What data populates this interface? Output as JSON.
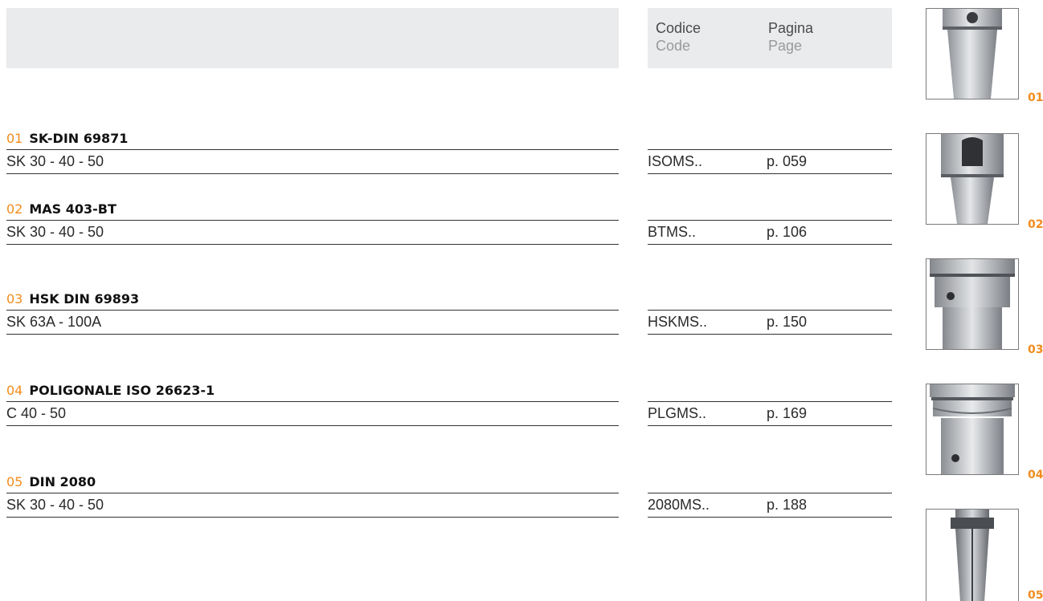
{
  "header": {
    "code_it": "Codice",
    "code_en": "Code",
    "page_it": "Pagina",
    "page_en": "Page"
  },
  "sections": [
    {
      "num": "01",
      "title": "SK-DIN 69871",
      "spec": "SK 30 - 40 - 50",
      "code": "ISOMS..",
      "page": "p. 059"
    },
    {
      "num": "02",
      "title": "MAS 403-BT",
      "spec": "SK 30 - 40 - 50",
      "code": "BTMS..",
      "page": "p. 106"
    },
    {
      "num": "03",
      "title": "HSK DIN 69893",
      "spec": "SK 63A - 100A",
      "code": "HSKMS..",
      "page": "p. 150"
    },
    {
      "num": "04",
      "title": "POLIGONALE ISO 26623-1",
      "spec": "C 40 - 50",
      "code": "PLGMS..",
      "page": "p. 169"
    },
    {
      "num": "05",
      "title": "DIN 2080",
      "spec": "SK 30 - 40 - 50",
      "code": "2080MS..",
      "page": "p. 188"
    }
  ],
  "thumbnails": [
    {
      "label": "01",
      "icon": "sk-din-toolholder-image"
    },
    {
      "label": "02",
      "icon": "bt-toolholder-image"
    },
    {
      "label": "03",
      "icon": "hsk-toolholder-image"
    },
    {
      "label": "04",
      "icon": "polygonal-toolholder-image"
    },
    {
      "label": "05",
      "icon": "din2080-toolholder-image"
    }
  ],
  "colors": {
    "accent": "#f28c1e",
    "header_bg": "#e9ebec",
    "rule": "#333333"
  }
}
